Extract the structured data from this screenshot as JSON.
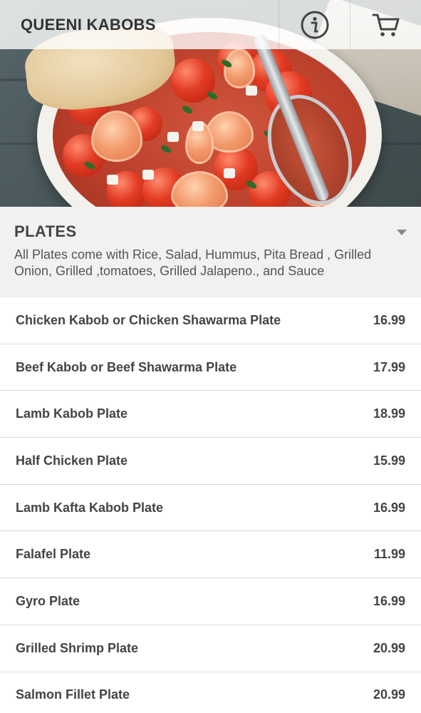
{
  "header": {
    "restaurant_name": "QUEENI KABOBS",
    "info_icon": "info-icon",
    "cart_icon": "cart-icon"
  },
  "hero": {
    "description": "shrimp-tomato-dish-photo"
  },
  "category": {
    "title": "PLATES",
    "description": "All Plates come with Rice, Salad, Hummus, Pita Bread , Grilled Onion, Grilled ,tomatoes, Grilled Jalapeno., and Sauce",
    "toggle_icon": "caret-down-icon"
  },
  "menu": {
    "items": [
      {
        "name": "Chicken Kabob or Chicken Shawarma Plate",
        "price": "16.99"
      },
      {
        "name": "Beef Kabob or Beef Shawarma Plate",
        "price": "17.99"
      },
      {
        "name": "Lamb Kabob Plate",
        "price": "18.99"
      },
      {
        "name": "Half Chicken Plate",
        "price": "15.99"
      },
      {
        "name": "Lamb Kafta Kabob Plate",
        "price": "16.99"
      },
      {
        "name": "Falafel Plate",
        "price": "11.99"
      },
      {
        "name": "Gyro Plate",
        "price": "16.99"
      },
      {
        "name": "Grilled Shrimp Plate",
        "price": "20.99"
      },
      {
        "name": "Salmon Fillet Plate",
        "price": "20.99"
      }
    ]
  },
  "colors": {
    "header_bg": "#ffffffcc",
    "category_bg": "#f1f1f1",
    "text": "#444444",
    "divider": "#d9d9d9"
  }
}
